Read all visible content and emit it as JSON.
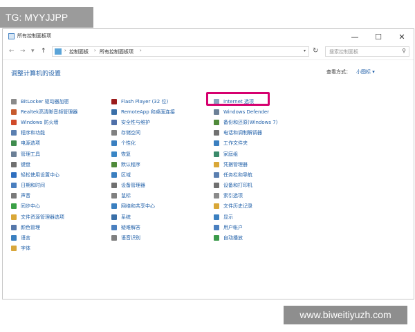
{
  "watermark_top": "TG: MYYJJPP",
  "watermark_bottom": "www.biweitiyuzh.com",
  "window": {
    "title": "所有控制面板项",
    "controls": {
      "minimize": "—",
      "maximize": "☐",
      "close": "✕"
    }
  },
  "nav": {
    "back": "←",
    "forward": "→",
    "dropdown": "▾",
    "up": "↑"
  },
  "address": {
    "segments": [
      "控制面板",
      "所有控制面板项"
    ],
    "separator": "›",
    "dropdown": "▾"
  },
  "refresh": "↻",
  "search": {
    "placeholder": "搜索控制面板"
  },
  "heading": "调整计算机的设置",
  "view_by": {
    "label": "查看方式：",
    "value": "小图标 ▾"
  },
  "columns": [
    [
      {
        "label": "BitLocker 驱动器加密",
        "icon": "bitlocker-icon",
        "color": "#8a8a8a"
      },
      {
        "label": "Realtek高清晰音频管理器",
        "icon": "realtek-audio-icon",
        "color": "#c65a2e"
      },
      {
        "label": "Windows 防火墙",
        "icon": "firewall-icon",
        "color": "#d04a2a"
      },
      {
        "label": "程序和功能",
        "icon": "programs-icon",
        "color": "#5a7fb0"
      },
      {
        "label": "电源选项",
        "icon": "power-icon",
        "color": "#3f8c4e"
      },
      {
        "label": "管理工具",
        "icon": "admin-tools-icon",
        "color": "#6b7f96"
      },
      {
        "label": "键盘",
        "icon": "keyboard-icon",
        "color": "#707070"
      },
      {
        "label": "轻松使用设置中心",
        "icon": "ease-of-access-icon",
        "color": "#2f6fbf"
      },
      {
        "label": "日期和时间",
        "icon": "date-time-icon",
        "color": "#4a7fbf"
      },
      {
        "label": "声音",
        "icon": "sound-icon",
        "color": "#7a7a7a"
      },
      {
        "label": "同步中心",
        "icon": "sync-center-icon",
        "color": "#3aa046"
      },
      {
        "label": "文件资源管理器选项",
        "icon": "folder-options-icon",
        "color": "#d9a737"
      },
      {
        "label": "颜色管理",
        "icon": "color-management-icon",
        "color": "#5577aa"
      },
      {
        "label": "语言",
        "icon": "language-icon",
        "color": "#3a7fc0"
      },
      {
        "label": "字体",
        "icon": "fonts-icon",
        "color": "#d8a63a"
      }
    ],
    [
      {
        "label": "Flash Player (32 位)",
        "icon": "flash-player-icon",
        "color": "#9b1b1b"
      },
      {
        "label": "RemoteApp 和桌面连接",
        "icon": "remoteapp-icon",
        "color": "#3a6fa8"
      },
      {
        "label": "安全性与维护",
        "icon": "security-maintenance-icon",
        "color": "#4f6fa8"
      },
      {
        "label": "存储空间",
        "icon": "storage-spaces-icon",
        "color": "#808080"
      },
      {
        "label": "个性化",
        "icon": "personalization-icon",
        "color": "#3a7fc0"
      },
      {
        "label": "恢复",
        "icon": "recovery-icon",
        "color": "#3a86c5"
      },
      {
        "label": "默认程序",
        "icon": "default-programs-icon",
        "color": "#4f8a3a"
      },
      {
        "label": "区域",
        "icon": "region-icon",
        "color": "#3a7fc0"
      },
      {
        "label": "设备管理器",
        "icon": "device-manager-icon",
        "color": "#707070"
      },
      {
        "label": "鼠标",
        "icon": "mouse-icon",
        "color": "#808080"
      },
      {
        "label": "网络和共享中心",
        "icon": "network-sharing-icon",
        "color": "#3a7fc0"
      },
      {
        "label": "系统",
        "icon": "system-icon",
        "color": "#3a6fa8"
      },
      {
        "label": "疑难解答",
        "icon": "troubleshooting-icon",
        "color": "#4a7fbf"
      },
      {
        "label": "语音识别",
        "icon": "speech-recognition-icon",
        "color": "#808080"
      }
    ],
    [
      {
        "label": "Internet 选项",
        "icon": "internet-options-icon",
        "color": "#8aa3c0"
      },
      {
        "label": "Windows Defender",
        "icon": "windows-defender-icon",
        "color": "#6b7f96"
      },
      {
        "label": "备份和还原(Windows 7)",
        "icon": "backup-restore-icon",
        "color": "#4f8a3a"
      },
      {
        "label": "电话和调制解调器",
        "icon": "phone-modem-icon",
        "color": "#707070"
      },
      {
        "label": "工作文件夹",
        "icon": "work-folders-icon",
        "color": "#3a7fc0"
      },
      {
        "label": "家庭组",
        "icon": "homegroup-icon",
        "color": "#3a8a6a"
      },
      {
        "label": "凭据管理器",
        "icon": "credential-manager-icon",
        "color": "#d9a737"
      },
      {
        "label": "任务栏和导航",
        "icon": "taskbar-navigation-icon",
        "color": "#5a7fb0"
      },
      {
        "label": "设备和打印机",
        "icon": "devices-printers-icon",
        "color": "#707070"
      },
      {
        "label": "索引选项",
        "icon": "indexing-options-icon",
        "color": "#8a8a8a"
      },
      {
        "label": "文件历史记录",
        "icon": "file-history-icon",
        "color": "#d9a737"
      },
      {
        "label": "显示",
        "icon": "display-icon",
        "color": "#3a7fc0"
      },
      {
        "label": "用户帐户",
        "icon": "user-accounts-icon",
        "color": "#4a7fbf"
      },
      {
        "label": "自动播放",
        "icon": "autoplay-icon",
        "color": "#3a9a4a"
      }
    ]
  ],
  "highlight_color": "#d6006f"
}
